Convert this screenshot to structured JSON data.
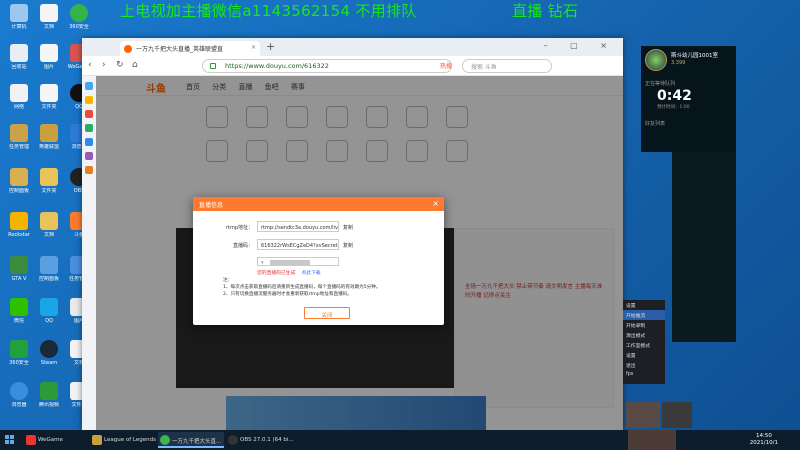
{
  "banner": {
    "left": "上电视加主播微信a1143562154 不用排队",
    "right": "直播 钻石"
  },
  "browser": {
    "tab_title": "一万九千把大头直播_英雄联盟直",
    "url": "https://www.douyu.com/616322",
    "search_placeholder": "搜索 斗鱼",
    "hot_label": "热搜"
  },
  "douyu": {
    "logo": "斗鱼",
    "nav": "首页 分类 直播 鱼吧 赛事",
    "chat_note": "全场一万九千把大头 禁止带节奏 请文明发言 主播每天准时开播 记得点关注"
  },
  "modal": {
    "title": "直播信息",
    "close_symbol": "×",
    "rtmp_label": "rtmp地址：",
    "rtmp_value": "rtmp://sendtc3a.douyu.com/live",
    "stream_label": "直播码：",
    "stream_value": "616322rWsECgZeD4?xvSecret=****",
    "copy_label": "复制",
    "select_hint": "▾",
    "warn_text": "您的直播码已生成",
    "warn_link": "点此下载",
    "notes_title": "注：",
    "note1": "1、每次点击获取直播码后请重新生成直播码，每个直播码的有效期为5分钟。",
    "note2": "2、只有切换直播流服务器时才会重新获取rtmp地址和直播码。",
    "close_button": "关闭"
  },
  "lol": {
    "room_name": "斯斗幼儿园1001室",
    "score": "3,399",
    "queue_label": "正在等待队列",
    "timer": "0:42",
    "estimate": "预计时间：1:00",
    "friends_label": "好友列表"
  },
  "obs_menu": [
    "设置",
    "开始推流",
    "开始录制",
    "演出模式",
    "工作室模式",
    "设置",
    "退出",
    "fps"
  ],
  "taskbar": {
    "tasks": [
      "WeGame",
      "League of Legends",
      "一万九千把大头直...",
      "OBS 27.0.1 (64 bi..."
    ],
    "time": "14:50",
    "date": "2021/10/1"
  },
  "desktop_icons": [
    "计算机",
    "回收站",
    "360安全",
    "网络",
    "QQ",
    "英雄联盟",
    "WeGame",
    "斗鱼",
    "微信",
    "腾讯视频",
    "OBS",
    "Steam",
    "任务管理",
    "控制面板",
    "Rockstar",
    "GTA V",
    "文件夹",
    "文档",
    "图片",
    "浏览器"
  ],
  "colors": {
    "banner_green": "#17e817",
    "douyu_orange": "#ff7a2e",
    "desktop_blue": "#1a7bd0"
  }
}
